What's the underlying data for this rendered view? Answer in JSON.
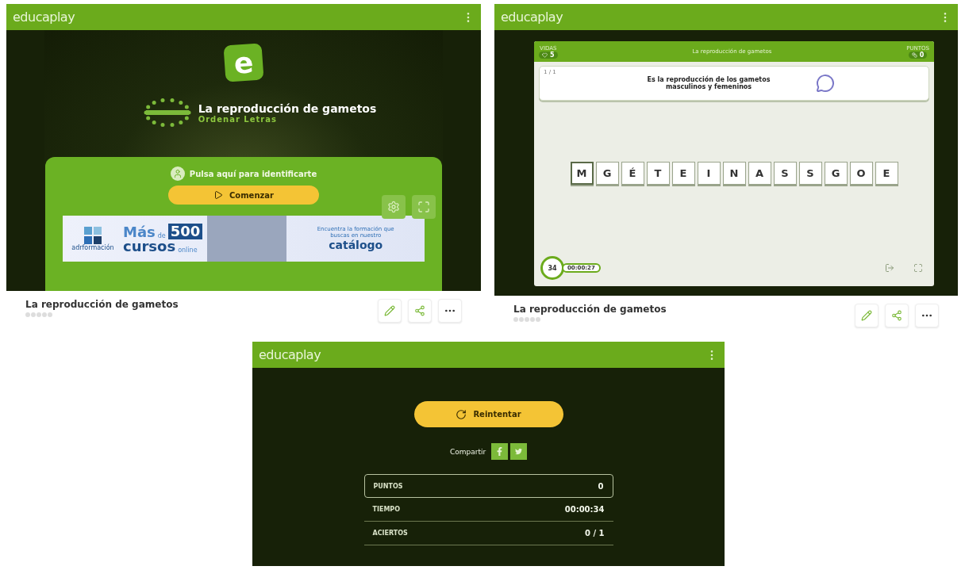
{
  "intro_screen": {
    "brand": "educaplay",
    "logo_letter": "e",
    "title": "La reproducción de gametos",
    "subtitle": "Ordenar Letras",
    "login_link": "Pulsa aquí para identificarte",
    "start_button": "Comenzar",
    "ad": {
      "line_1": "Más",
      "line_1b": "de",
      "number": "500",
      "line_2": "cursos",
      "line_2b": "online",
      "brand": "adrformación",
      "tagline": "Encuentra la formación que buscas en nuestro",
      "tagline_big": "catálogo"
    },
    "footer": {
      "title": "La reproducción de gametos",
      "stars": 0
    }
  },
  "game_screen": {
    "brand": "educaplay",
    "lives_label": "VIDAS",
    "lives": "5",
    "title": "La reproducción de gametos",
    "points_label": "PUNTOS",
    "points": "0",
    "counter": "1 / 1",
    "question": "Es la reproducción de los gametos masculinos y femeninos",
    "tiles": [
      {
        "letter": "M",
        "selected": true
      },
      {
        "letter": "G",
        "selected": false
      },
      {
        "letter": "É",
        "selected": false
      },
      {
        "letter": "T",
        "selected": false
      },
      {
        "letter": "E",
        "selected": false
      },
      {
        "letter": "I",
        "selected": false
      },
      {
        "letter": "N",
        "selected": false
      },
      {
        "letter": "A",
        "selected": false
      },
      {
        "letter": "S",
        "selected": false
      },
      {
        "letter": "S",
        "selected": false
      },
      {
        "letter": "G",
        "selected": false
      },
      {
        "letter": "O",
        "selected": false
      },
      {
        "letter": "E",
        "selected": false
      }
    ],
    "timer": {
      "seconds": "34",
      "clock": "00:00:27"
    },
    "footer": {
      "title": "La reproducción de gametos",
      "stars": 0
    }
  },
  "results_screen": {
    "brand": "educaplay",
    "retry_button": "Reintentar",
    "share_label": "Compartir",
    "stats": [
      {
        "label": "PUNTOS",
        "value": "0",
        "highlighted": true
      },
      {
        "label": "TIEMPO",
        "value": "00:00:34",
        "highlighted": false
      },
      {
        "label": "ACIERTOS",
        "value": "0 / 1",
        "highlighted": false
      }
    ]
  }
}
